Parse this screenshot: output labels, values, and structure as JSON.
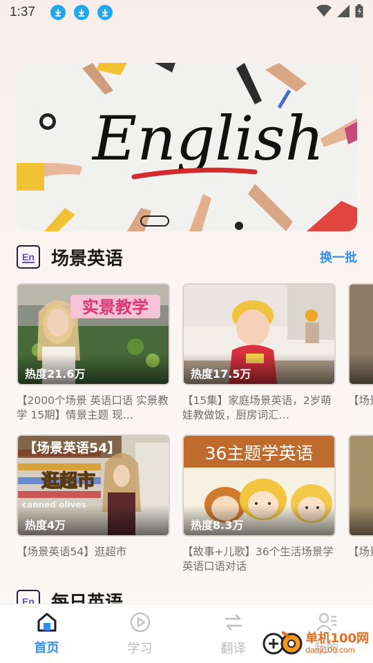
{
  "status": {
    "time": "1:37",
    "download_icons": [
      "download-icon",
      "download-icon",
      "download-icon"
    ]
  },
  "banner": {
    "text": "English"
  },
  "sections": [
    {
      "title": "场景英语",
      "action": "换一批",
      "cards": [
        {
          "overlay": "实景教学",
          "heat": "热度21.6万",
          "title": "【2000个场景 英语口语 实景教学 15期】情景主题 现…"
        },
        {
          "overlay": "",
          "heat": "热度17.5万",
          "title": "【15集】家庭场景英语，2岁萌娃教做饭，厨房词汇…"
        },
        {
          "overlay": "【场景英语54】",
          "overlay2": "逛超市",
          "overlay3": "canned olives",
          "heat": "热度4万",
          "title": "【场景英语54】逛超市"
        },
        {
          "overlay": "36主题学英语",
          "heat": "热度8.3万",
          "title": "【故事+儿歌】36个生活场景学英语口语对话"
        }
      ],
      "partial_cards": [
        {
          "title": "【场景英语"
        },
        {
          "title": "【场景英语"
        }
      ]
    },
    {
      "title": "每日英语"
    }
  ],
  "tabbar": {
    "tabs": [
      {
        "label": "首页",
        "icon": "home-icon",
        "active": true
      },
      {
        "label": "学习",
        "icon": "play-circle-icon",
        "active": false
      },
      {
        "label": "翻译",
        "icon": "swap-icon",
        "active": false
      },
      {
        "label": "我的",
        "icon": "user-list-icon",
        "active": false
      }
    ]
  },
  "watermark": {
    "name": "单机100网",
    "url": "danji100.com"
  },
  "colors": {
    "accent": "#2f8ef5",
    "download_badge": "#1ea7f3",
    "watermark": "#f06a1d"
  }
}
